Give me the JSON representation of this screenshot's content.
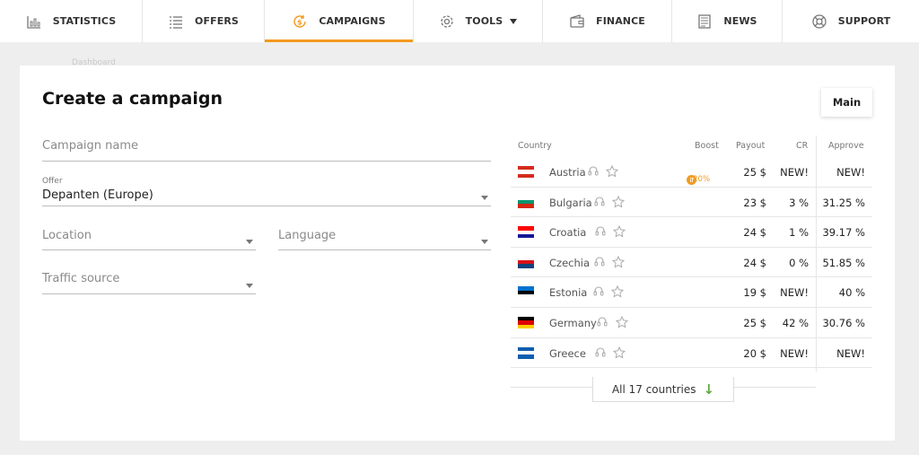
{
  "nav": {
    "items": [
      {
        "label": "STATISTICS",
        "icon": "bar-chart-icon"
      },
      {
        "label": "OFFERS",
        "icon": "list-icon"
      },
      {
        "label": "CAMPAIGNS",
        "icon": "dollar-refresh-icon",
        "active": true
      },
      {
        "label": "TOOLS",
        "icon": "gear-icon",
        "has_caret": true
      },
      {
        "label": "FINANCE",
        "icon": "wallet-icon"
      },
      {
        "label": "NEWS",
        "icon": "newspaper-icon"
      },
      {
        "label": "SUPPORT",
        "icon": "lifebuoy-icon"
      }
    ],
    "accent": "#f39a1e"
  },
  "breadcrumb": "Dashboard",
  "page": {
    "title": "Create a campaign",
    "main_button": "Main"
  },
  "form": {
    "campaign_name_placeholder": "Campaign name",
    "offer_label": "Offer",
    "offer_value": "Depanten (Europe)",
    "location_placeholder": "Location",
    "language_placeholder": "Language",
    "traffic_source_placeholder": "Traffic source"
  },
  "countries": {
    "headers": {
      "country": "Country",
      "boost": "Boost",
      "payout": "Payout",
      "cr": "CR",
      "approve": "Approve"
    },
    "rows": [
      {
        "name": "Austria",
        "boost": "+20%",
        "payout": "25 $",
        "cr": "NEW!",
        "approve": "NEW!",
        "flag": [
          "#d52b1e",
          "#ffffff",
          "#d52b1e"
        ]
      },
      {
        "name": "Bulgaria",
        "boost": "",
        "payout": "23 $",
        "cr": "3 %",
        "approve": "31.25 %",
        "flag": [
          "#ffffff",
          "#00966e",
          "#d62612"
        ]
      },
      {
        "name": "Croatia",
        "boost": "",
        "payout": "24 $",
        "cr": "1 %",
        "approve": "39.17 %",
        "flag": [
          "#ff0000",
          "#ffffff",
          "#171796"
        ]
      },
      {
        "name": "Czechia",
        "boost": "",
        "payout": "24 $",
        "cr": "0 %",
        "approve": "51.85 %",
        "flag": [
          "#ffffff",
          "#d7141a",
          "#11457e"
        ]
      },
      {
        "name": "Estonia",
        "boost": "",
        "payout": "19 $",
        "cr": "NEW!",
        "approve": "40 %",
        "flag": [
          "#0072ce",
          "#000000",
          "#ffffff"
        ]
      },
      {
        "name": "Germany",
        "boost": "",
        "payout": "25 $",
        "cr": "42 %",
        "approve": "30.76 %",
        "flag": [
          "#000000",
          "#dd0000",
          "#ffce00"
        ]
      },
      {
        "name": "Greece",
        "boost": "",
        "payout": "20 $",
        "cr": "NEW!",
        "approve": "NEW!",
        "flag": [
          "#0d5eaf",
          "#ffffff",
          "#0d5eaf"
        ]
      }
    ],
    "all_button": "All 17 countries"
  }
}
